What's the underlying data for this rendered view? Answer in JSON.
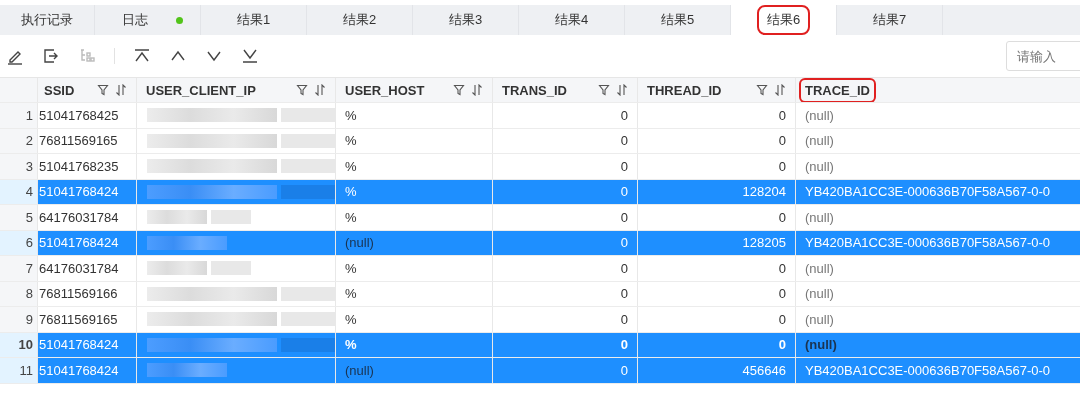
{
  "tabs": [
    {
      "label": "执行记录",
      "selected": false,
      "status_dot": false,
      "annotated": false
    },
    {
      "label": "日志",
      "selected": false,
      "status_dot": true,
      "annotated": false
    },
    {
      "label": "结果1",
      "selected": false,
      "status_dot": false,
      "annotated": false
    },
    {
      "label": "结果2",
      "selected": false,
      "status_dot": false,
      "annotated": false
    },
    {
      "label": "结果3",
      "selected": false,
      "status_dot": false,
      "annotated": false
    },
    {
      "label": "结果4",
      "selected": false,
      "status_dot": false,
      "annotated": false
    },
    {
      "label": "结果5",
      "selected": false,
      "status_dot": false,
      "annotated": false
    },
    {
      "label": "结果6",
      "selected": true,
      "status_dot": false,
      "annotated": true
    },
    {
      "label": "结果7",
      "selected": false,
      "status_dot": false,
      "annotated": false
    }
  ],
  "toolbar": {
    "tools": [
      {
        "kind": "edit",
        "disabled": false
      },
      {
        "kind": "export",
        "disabled": false
      },
      {
        "kind": "tree",
        "disabled": true
      },
      {
        "kind": "sep"
      },
      {
        "kind": "first",
        "disabled": false
      },
      {
        "kind": "prev",
        "disabled": false
      },
      {
        "kind": "next",
        "disabled": false
      },
      {
        "kind": "last",
        "disabled": false
      }
    ],
    "search": {
      "placeholder": "请输入"
    }
  },
  "table": {
    "columns": [
      {
        "label": "SSID",
        "filterable": true,
        "annotated": false
      },
      {
        "label": "USER_CLIENT_IP",
        "filterable": true,
        "annotated": false
      },
      {
        "label": "USER_HOST",
        "filterable": true,
        "annotated": false
      },
      {
        "label": "TRANS_ID",
        "filterable": true,
        "annotated": false
      },
      {
        "label": "THREAD_ID",
        "filterable": true,
        "annotated": false
      },
      {
        "label": "TRACE_ID",
        "filterable": false,
        "annotated": true
      }
    ],
    "rows": [
      {
        "num": "1",
        "selected": false,
        "current": false,
        "cells": [
          {
            "kind": "text",
            "text": "51041768425",
            "null": false
          },
          {
            "kind": "blurred",
            "text": ""
          },
          {
            "kind": "text",
            "text": "%",
            "null": false
          },
          {
            "kind": "number",
            "text": "0",
            "null": false
          },
          {
            "kind": "number",
            "text": "0",
            "null": false
          },
          {
            "kind": "text",
            "text": "(null)",
            "null": true
          }
        ]
      },
      {
        "num": "2",
        "selected": false,
        "current": false,
        "cells": [
          {
            "kind": "text",
            "text": "76811569165",
            "null": false
          },
          {
            "kind": "blurred",
            "text": ""
          },
          {
            "kind": "text",
            "text": "%",
            "null": false
          },
          {
            "kind": "number",
            "text": "0",
            "null": false
          },
          {
            "kind": "number",
            "text": "0",
            "null": false
          },
          {
            "kind": "text",
            "text": "(null)",
            "null": true
          }
        ]
      },
      {
        "num": "3",
        "selected": false,
        "current": false,
        "cells": [
          {
            "kind": "text",
            "text": "51041768235",
            "null": false
          },
          {
            "kind": "blurred",
            "text": ""
          },
          {
            "kind": "text",
            "text": "%",
            "null": false
          },
          {
            "kind": "number",
            "text": "0",
            "null": false
          },
          {
            "kind": "number",
            "text": "0",
            "null": false
          },
          {
            "kind": "text",
            "text": "(null)",
            "null": true
          }
        ]
      },
      {
        "num": "4",
        "selected": true,
        "current": false,
        "cells": [
          {
            "kind": "text",
            "text": "51041768424",
            "null": false
          },
          {
            "kind": "blurred",
            "text": ""
          },
          {
            "kind": "text",
            "text": "%",
            "null": false
          },
          {
            "kind": "number",
            "text": "0",
            "null": false
          },
          {
            "kind": "number",
            "text": "128204",
            "null": false
          },
          {
            "kind": "text",
            "text": "YB420BA1CC3E-000636B70F58A567-0-0",
            "null": false
          }
        ]
      },
      {
        "num": "5",
        "selected": false,
        "current": false,
        "cells": [
          {
            "kind": "text",
            "text": "64176031784",
            "null": false
          },
          {
            "kind": "blurred",
            "text": ""
          },
          {
            "kind": "text",
            "text": "%",
            "null": false
          },
          {
            "kind": "number",
            "text": "0",
            "null": false
          },
          {
            "kind": "number",
            "text": "0",
            "null": false
          },
          {
            "kind": "text",
            "text": "(null)",
            "null": true
          }
        ]
      },
      {
        "num": "6",
        "selected": true,
        "current": false,
        "cells": [
          {
            "kind": "text",
            "text": "51041768424",
            "null": false
          },
          {
            "kind": "blurred",
            "text": ""
          },
          {
            "kind": "text",
            "text": "(null)",
            "null": true
          },
          {
            "kind": "number",
            "text": "0",
            "null": false
          },
          {
            "kind": "number",
            "text": "128205",
            "null": false
          },
          {
            "kind": "text",
            "text": "YB420BA1CC3E-000636B70F58A567-0-0",
            "null": false
          }
        ]
      },
      {
        "num": "7",
        "selected": false,
        "current": false,
        "cells": [
          {
            "kind": "text",
            "text": "64176031784",
            "null": false
          },
          {
            "kind": "blurred",
            "text": ""
          },
          {
            "kind": "text",
            "text": "%",
            "null": false
          },
          {
            "kind": "number",
            "text": "0",
            "null": false
          },
          {
            "kind": "number",
            "text": "0",
            "null": false
          },
          {
            "kind": "text",
            "text": "(null)",
            "null": true
          }
        ]
      },
      {
        "num": "8",
        "selected": false,
        "current": false,
        "cells": [
          {
            "kind": "text",
            "text": "76811569166",
            "null": false
          },
          {
            "kind": "blurred",
            "text": ""
          },
          {
            "kind": "text",
            "text": "%",
            "null": false
          },
          {
            "kind": "number",
            "text": "0",
            "null": false
          },
          {
            "kind": "number",
            "text": "0",
            "null": false
          },
          {
            "kind": "text",
            "text": "(null)",
            "null": true
          }
        ]
      },
      {
        "num": "9",
        "selected": false,
        "current": false,
        "cells": [
          {
            "kind": "text",
            "text": "76811569165",
            "null": false
          },
          {
            "kind": "blurred",
            "text": ""
          },
          {
            "kind": "text",
            "text": "%",
            "null": false
          },
          {
            "kind": "number",
            "text": "0",
            "null": false
          },
          {
            "kind": "number",
            "text": "0",
            "null": false
          },
          {
            "kind": "text",
            "text": "(null)",
            "null": true
          }
        ]
      },
      {
        "num": "10",
        "selected": true,
        "current": true,
        "cells": [
          {
            "kind": "text",
            "text": "51041768424",
            "null": false
          },
          {
            "kind": "blurred",
            "text": ""
          },
          {
            "kind": "text",
            "text": "%",
            "null": false
          },
          {
            "kind": "number",
            "text": "0",
            "null": false
          },
          {
            "kind": "number",
            "text": "0",
            "null": false
          },
          {
            "kind": "text",
            "text": "(null)",
            "null": true
          }
        ]
      },
      {
        "num": "11",
        "selected": true,
        "current": false,
        "cells": [
          {
            "kind": "text",
            "text": "51041768424",
            "null": false
          },
          {
            "kind": "blurred",
            "text": ""
          },
          {
            "kind": "text",
            "text": "(null)",
            "null": true
          },
          {
            "kind": "number",
            "text": "0",
            "null": false
          },
          {
            "kind": "number",
            "text": "456646",
            "null": false
          },
          {
            "kind": "text",
            "text": "YB420BA1CC3E-000636B70F58A567-0-0",
            "null": false
          }
        ]
      }
    ]
  }
}
